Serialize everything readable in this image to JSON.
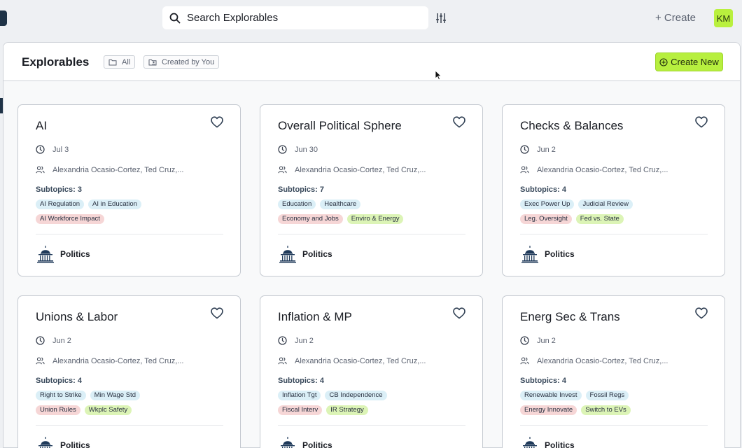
{
  "header": {
    "search_placeholder": "Search Explorables",
    "create_label": "+ Create",
    "avatar_initials": "KM"
  },
  "panel": {
    "title": "Explorables",
    "filters": [
      {
        "label": "All",
        "icon": "folder-icon"
      },
      {
        "label": "Created by You",
        "icon": "folder-user-icon"
      }
    ],
    "create_new_label": "Create New"
  },
  "colors": {
    "accent": "#b7ef3f",
    "tag_blue": "#dbeff7",
    "tag_red": "#f6d6d6",
    "tag_green": "#dcf4b6",
    "nav_dark": "#1f3347"
  },
  "cards": [
    {
      "title": "AI",
      "date": "Jul 3",
      "participants": "Alexandria Ocasio-Cortez, Ted Cruz,...",
      "subtopics_label": "Subtopics: 3",
      "tags": [
        [
          {
            "label": "AI Regulation",
            "color": "blue"
          },
          {
            "label": "AI in Education",
            "color": "blue"
          }
        ],
        [
          {
            "label": "AI Workforce Impact",
            "color": "red"
          }
        ]
      ],
      "category": "Politics"
    },
    {
      "title": "Overall Political Sphere",
      "date": "Jun 30",
      "participants": "Alexandria Ocasio-Cortez, Ted Cruz,...",
      "subtopics_label": "Subtopics: 7",
      "tags": [
        [
          {
            "label": "Education",
            "color": "blue"
          },
          {
            "label": "Healthcare",
            "color": "blue"
          }
        ],
        [
          {
            "label": "Economy and Jobs",
            "color": "red"
          },
          {
            "label": "Enviro & Energy",
            "color": "green"
          }
        ]
      ],
      "category": "Politics"
    },
    {
      "title": "Checks & Balances",
      "date": "Jun 2",
      "participants": "Alexandria Ocasio-Cortez, Ted Cruz,...",
      "subtopics_label": "Subtopics: 4",
      "tags": [
        [
          {
            "label": "Exec Power Up",
            "color": "blue"
          },
          {
            "label": "Judicial Review",
            "color": "blue"
          }
        ],
        [
          {
            "label": "Leg. Oversight",
            "color": "red"
          },
          {
            "label": "Fed vs. State",
            "color": "green"
          }
        ]
      ],
      "category": "Politics"
    },
    {
      "title": "Unions & Labor",
      "date": "Jun 2",
      "participants": "Alexandria Ocasio-Cortez, Ted Cruz,...",
      "subtopics_label": "Subtopics: 4",
      "tags": [
        [
          {
            "label": "Right to Strike",
            "color": "blue"
          },
          {
            "label": "Min Wage Std",
            "color": "blue"
          }
        ],
        [
          {
            "label": "Union Rules",
            "color": "red"
          },
          {
            "label": "Wkplc Safety",
            "color": "green"
          }
        ]
      ],
      "category": "Politics"
    },
    {
      "title": "Inflation & MP",
      "date": "Jun 2",
      "participants": "Alexandria Ocasio-Cortez, Ted Cruz,...",
      "subtopics_label": "Subtopics: 4",
      "tags": [
        [
          {
            "label": "Inflation Tgt",
            "color": "blue"
          },
          {
            "label": "CB Independence",
            "color": "blue"
          }
        ],
        [
          {
            "label": "Fiscal Interv",
            "color": "red"
          },
          {
            "label": "IR Strategy",
            "color": "green"
          }
        ]
      ],
      "category": "Politics"
    },
    {
      "title": "Energ Sec & Trans",
      "date": "Jun 2",
      "participants": "Alexandria Ocasio-Cortez, Ted Cruz,...",
      "subtopics_label": "Subtopics: 4",
      "tags": [
        [
          {
            "label": "Renewable Invest",
            "color": "blue"
          },
          {
            "label": "Fossil Regs",
            "color": "blue"
          }
        ],
        [
          {
            "label": "Energy Innovate",
            "color": "red"
          },
          {
            "label": "Switch to EVs",
            "color": "green"
          }
        ]
      ],
      "category": "Politics"
    }
  ]
}
